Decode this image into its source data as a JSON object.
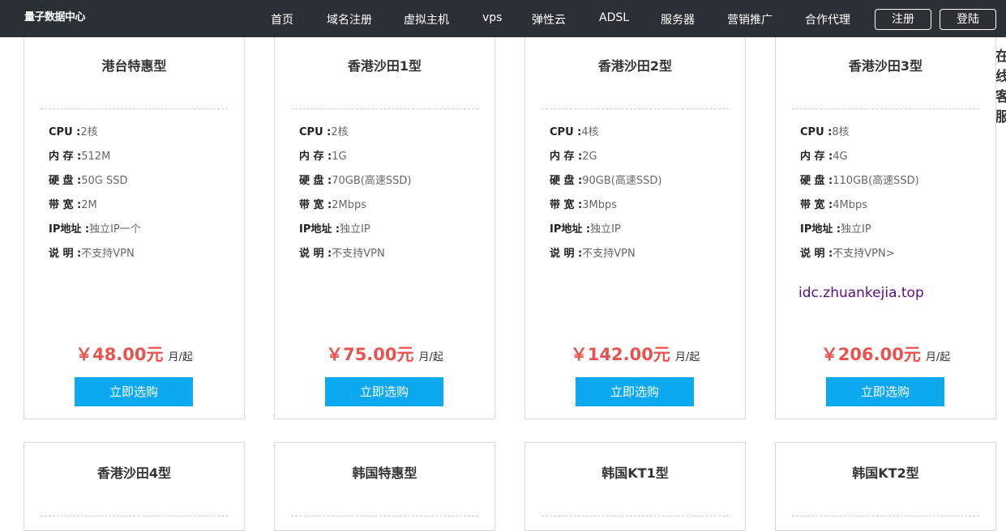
{
  "header": {
    "logo": "量子数据中心",
    "nav": [
      "首页",
      "域名注册",
      "虚拟主机",
      "vps",
      "弹性云",
      "ADSL",
      "服务器",
      "营销推广",
      "合作代理"
    ],
    "register": "注册",
    "login": "登陆"
  },
  "side": {
    "label": "在线客服"
  },
  "watermark": "idc.zhuankejia.top",
  "spec_labels": {
    "cpu": "CPU :",
    "mem": "内  存 :",
    "disk": "硬 盘 :",
    "bw": "带 宽 :",
    "ip": "IP地址 :",
    "note": "说 明 :"
  },
  "buy_label": "立即选购",
  "price_unit": "月/起",
  "plans": [
    {
      "name": "港台特惠型",
      "cpu": "2核",
      "mem": "512M",
      "disk": "50G SSD",
      "bw": "2M",
      "ip": "独立IP一个",
      "note": "不支持VPN",
      "price": "￥48.00元"
    },
    {
      "name": "香港沙田1型",
      "cpu": "2核",
      "mem": "1G",
      "disk": "70GB(高速SSD)",
      "bw": "2Mbps",
      "ip": "独立IP",
      "note": "不支持VPN",
      "price": "￥75.00元"
    },
    {
      "name": "香港沙田2型",
      "cpu": "4核",
      "mem": "2G",
      "disk": "90GB(高速SSD)",
      "bw": "3Mbps",
      "ip": "独立IP",
      "note": "不支持VPN",
      "price": "￥142.00元"
    },
    {
      "name": "香港沙田3型",
      "cpu": "8核",
      "mem": "4G",
      "disk": "110GB(高速SSD)",
      "bw": "4Mbps",
      "ip": "独立IP",
      "note": "不支持VPN>",
      "price": "￥206.00元"
    },
    {
      "name": "香港沙田4型"
    },
    {
      "name": "韩国特惠型"
    },
    {
      "name": "韩国KT1型"
    },
    {
      "name": "韩国KT2型"
    }
  ]
}
